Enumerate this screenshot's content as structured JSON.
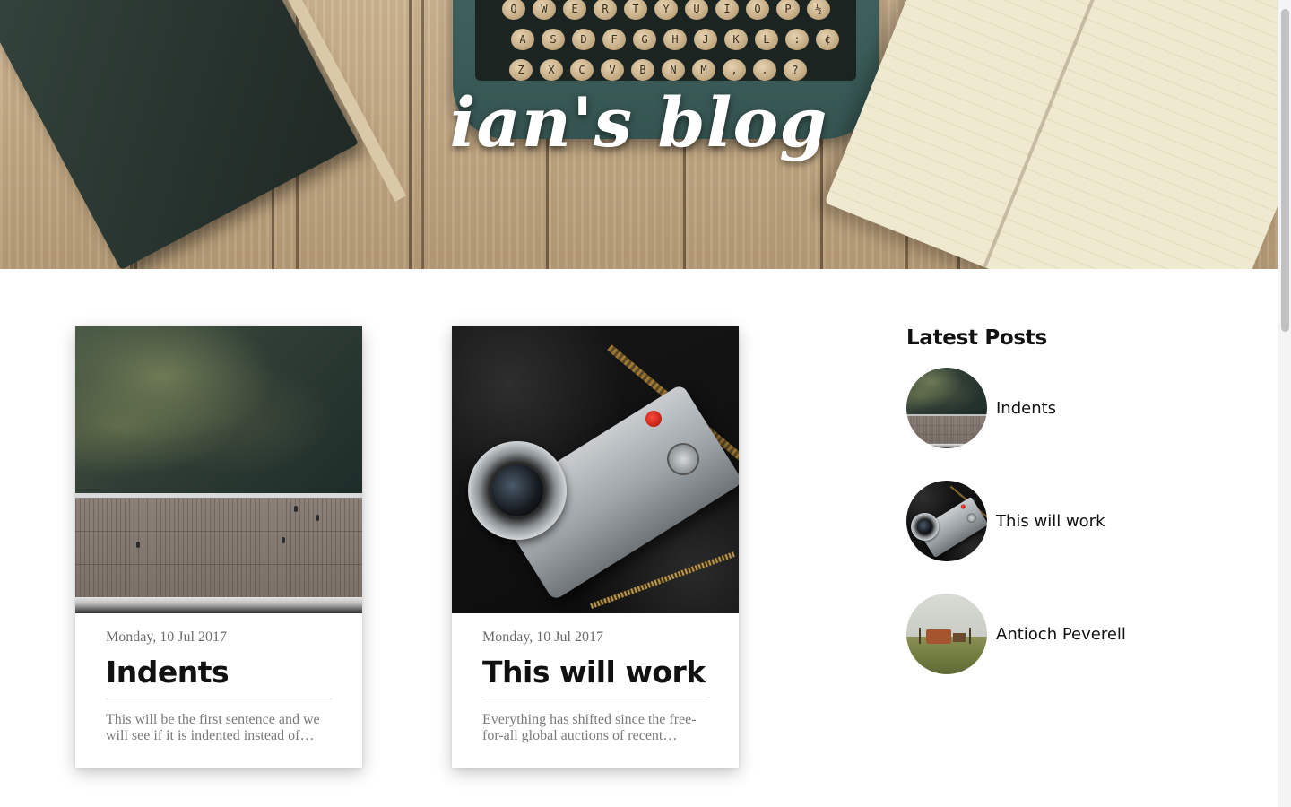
{
  "hero": {
    "title": "ian's blog",
    "keyboard_rows": [
      [
        "Q",
        "W",
        "E",
        "R",
        "T",
        "Y",
        "U",
        "I",
        "O",
        "P",
        "½"
      ],
      [
        "A",
        "S",
        "D",
        "F",
        "G",
        "H",
        "J",
        "K",
        "L",
        ":",
        "¢"
      ],
      [
        "Z",
        "X",
        "C",
        "V",
        "B",
        "N",
        "M",
        ",",
        ".",
        "?"
      ]
    ]
  },
  "posts": [
    {
      "date": "Monday, 10 Jul 2017",
      "title": "Indents",
      "excerpt": "This will be the first sentence and we will see if it is indented instead of…",
      "image": "pier-aerial"
    },
    {
      "date": "Monday, 10 Jul 2017",
      "title": "This will work",
      "excerpt": "Everything has shifted since the free-for-all global auctions of recent…",
      "image": "camera"
    }
  ],
  "sidebar": {
    "heading": "Latest Posts",
    "items": [
      {
        "label": "Indents",
        "thumb": "pier-aerial"
      },
      {
        "label": "This will work",
        "thumb": "camera"
      },
      {
        "label": "Antioch Peverell",
        "thumb": "field"
      }
    ]
  },
  "colors": {
    "background": "#ffffff",
    "title_text": "#111111",
    "date_text": "#6b6b6b",
    "excerpt_text": "#7a7a7a",
    "hero_title": "#ffffff"
  }
}
